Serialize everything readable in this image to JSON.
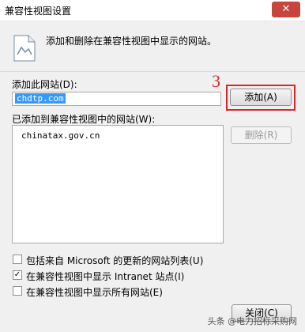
{
  "window": {
    "title": "兼容性视图设置",
    "close_glyph": "✕"
  },
  "intro_text": "添加和删除在兼容性视图中显示的网站。",
  "add_site": {
    "label": "添加此网站(D):",
    "input_value": "chdtp.com",
    "add_button": "添加(A)"
  },
  "annotation": {
    "step_number": "3",
    "color": "#d8262b"
  },
  "added_sites": {
    "label": "已添加到兼容性视图中的网站(W):",
    "items": [
      "chinatax.gov.cn"
    ],
    "remove_button": "删除(R)"
  },
  "options": [
    {
      "label": "包括来自 Microsoft 的更新的网站列表(U)",
      "checked": false
    },
    {
      "label": "在兼容性视图中显示 Intranet 站点(I)",
      "checked": true
    },
    {
      "label": "在兼容性视图中显示所有网站(E)",
      "checked": false
    }
  ],
  "close_button": "关闭(C)",
  "watermark": "头条 @电力招标采购网"
}
